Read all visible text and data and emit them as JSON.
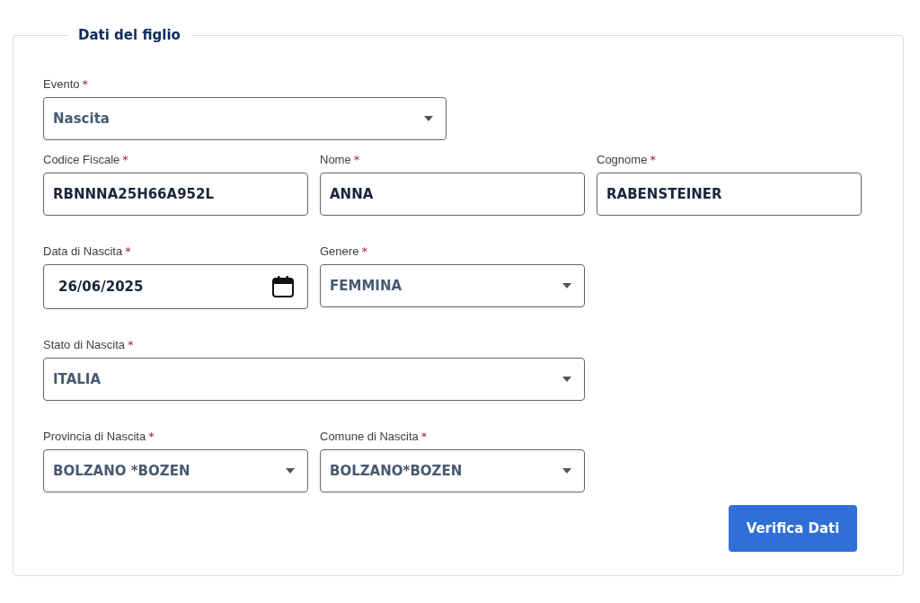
{
  "section": {
    "title": "Dati del figlio"
  },
  "rows": [
    [
      {
        "kind": "select",
        "label": "Evento",
        "asterisk": "*",
        "value": "Nascita"
      }
    ],
    [
      {
        "kind": "text",
        "label": "Codice Fiscale",
        "asterisk": "*",
        "value": "RBNNNA25H66A952L"
      },
      {
        "kind": "text",
        "label": "Nome",
        "asterisk": "*",
        "value": "ANNA"
      },
      {
        "kind": "text",
        "label": "Cognome",
        "asterisk": "*",
        "value": "RABENSTEINER"
      }
    ],
    [
      {
        "kind": "date",
        "label": "Data di Nascita",
        "asterisk": "*",
        "value": "26/06/2025"
      },
      {
        "kind": "select",
        "label": "Genere",
        "asterisk": "*",
        "value": "FEMMINA"
      }
    ],
    [
      {
        "kind": "select",
        "label": "Stato di Nascita",
        "asterisk": "*",
        "value": "ITALIA"
      }
    ],
    [
      {
        "kind": "select",
        "label": "Provincia di Nascita",
        "asterisk": "*",
        "value": "BOLZANO *BOZEN"
      },
      {
        "kind": "select",
        "label": "Comune di Nascita",
        "asterisk": "*",
        "value": "BOLZANO*BOZEN"
      }
    ]
  ],
  "submit_button": {
    "label": "Verifica Dati"
  }
}
